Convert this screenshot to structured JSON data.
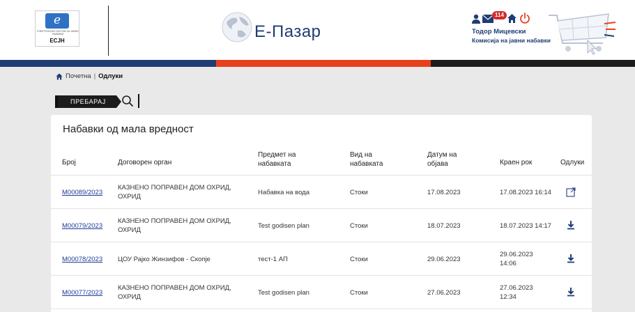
{
  "header": {
    "logo_small_text": "ЕЛЕКТРОНСКИ СИСТЕМ ЗА ЈАВНИ НАБАВКИ",
    "logo_abbr": "ЕСЈН",
    "brand": "Е-Пазар",
    "notification_count": "114",
    "user_name": "Тодор Мицевски",
    "user_org": "Комисија на јавни набавки"
  },
  "breadcrumb": {
    "home": "Почетна",
    "separator": "|",
    "current": "Одлуки"
  },
  "search": {
    "button_label": "ПРЕБАРАЈ"
  },
  "table": {
    "title": "Набавки од мала вредност",
    "headers": {
      "number": "Број",
      "authority": "Договорен орган",
      "subject": "Предмет на набавката",
      "type": "Вид на набавката",
      "pub_date": "Датум на објава",
      "deadline": "Краен рок",
      "decisions": "Одлуки"
    },
    "rows": [
      {
        "number": "M00089/2023",
        "authority": "КАЗНЕНО ПОПРАВЕН ДОМ ОХРИД, ОХРИД",
        "subject": "Набавка на вода",
        "type": "Стоки",
        "pub_date": "17.08.2023",
        "deadline": "17.08.2023 16:14",
        "action_icon": "external-link-icon"
      },
      {
        "number": "M00079/2023",
        "authority": "КАЗНЕНО ПОПРАВЕН ДОМ ОХРИД, ОХРИД",
        "subject": "Test godisen plan",
        "type": "Стоки",
        "pub_date": "18.07.2023",
        "deadline": "18.07.2023 14:17",
        "action_icon": "download-icon"
      },
      {
        "number": "M00078/2023",
        "authority": "ЦОУ Рајко Жинзифов - Скопје",
        "subject": "тест-1 АП",
        "type": "Стоки",
        "pub_date": "29.06.2023",
        "deadline": "29.06.2023 14:06",
        "action_icon": "download-icon"
      },
      {
        "number": "M00077/2023",
        "authority": "КАЗНЕНО ПОПРАВЕН ДОМ ОХРИД, ОХРИД",
        "subject": "Test godisen plan",
        "type": "Стоки",
        "pub_date": "27.06.2023",
        "deadline": "27.06.2023 12:34",
        "action_icon": "download-icon"
      }
    ]
  },
  "colors": {
    "brand_blue": "#1f3d73",
    "accent_red": "#e8401c",
    "dark": "#1c1c1c",
    "link": "#1f3d9a",
    "badge": "#d42b2b"
  }
}
